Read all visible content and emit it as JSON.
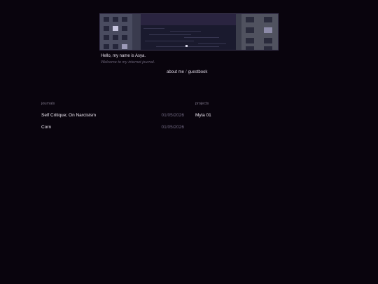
{
  "header": {
    "greeting": "Hello, my name is Asya.",
    "subtitle": "Welcome to my internet journal."
  },
  "nav": {
    "about_label": "about me",
    "separator": "/",
    "guestbook_label": "guestbook"
  },
  "journals": {
    "heading": "journals",
    "items": [
      {
        "title": "Self Critique; On Narcisism",
        "date": "01/05/2026"
      },
      {
        "title": "Corn",
        "date": "01/05/2026"
      }
    ]
  },
  "projects": {
    "heading": "projects",
    "items": [
      {
        "title": "Myla 01"
      }
    ]
  },
  "colors": {
    "background": "#09040d",
    "text": "#f0eaf4",
    "muted": "#6f6880"
  }
}
